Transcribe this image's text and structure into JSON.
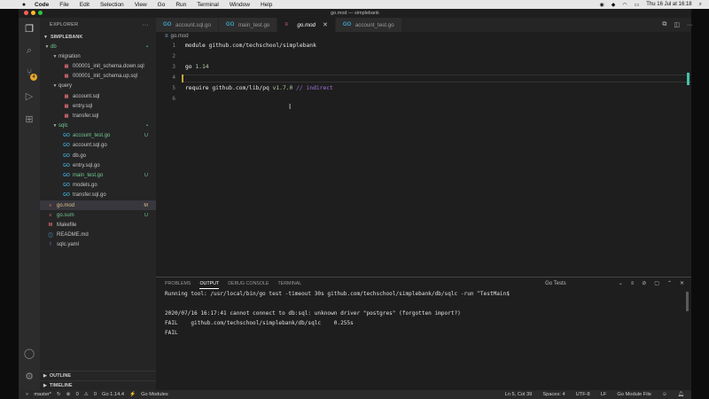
{
  "menubar": {
    "app": "Code",
    "items": [
      "File",
      "Edit",
      "Selection",
      "View",
      "Go",
      "Run",
      "Terminal",
      "Window",
      "Help"
    ],
    "window_title": "go.mod — simplebank",
    "clock": "Thu 16 Jul at  16:18"
  },
  "explorer": {
    "header": "EXPLORER",
    "project": "SIMPLEBANK",
    "tree": [
      {
        "label": "db",
        "type": "folder",
        "depth": 0,
        "open": true,
        "color": "#73c991",
        "status": "•",
        "status_color": "#73c991"
      },
      {
        "label": "migration",
        "type": "folder",
        "depth": 1,
        "open": true,
        "color": "#c5c5c5"
      },
      {
        "label": "000001_init_schema.down.sql",
        "type": "sql",
        "depth": 2,
        "color": "#c5c5c5"
      },
      {
        "label": "000001_init_schema.up.sql",
        "type": "sql",
        "depth": 2,
        "color": "#c5c5c5"
      },
      {
        "label": "query",
        "type": "folder",
        "depth": 1,
        "open": true,
        "color": "#c5c5c5"
      },
      {
        "label": "account.sql",
        "type": "sql",
        "depth": 2,
        "color": "#c5c5c5"
      },
      {
        "label": "entry.sql",
        "type": "sql",
        "depth": 2,
        "color": "#c5c5c5"
      },
      {
        "label": "transfer.sql",
        "type": "sql",
        "depth": 2,
        "color": "#c5c5c5"
      },
      {
        "label": "sqlc",
        "type": "folder",
        "depth": 1,
        "open": true,
        "color": "#73c991",
        "status": "•",
        "status_color": "#73c991"
      },
      {
        "label": "account_test.go",
        "type": "go",
        "depth": 2,
        "color": "#73c991",
        "status": "U",
        "status_color": "#73c991"
      },
      {
        "label": "account.sql.go",
        "type": "go",
        "depth": 2,
        "color": "#c5c5c5"
      },
      {
        "label": "db.go",
        "type": "go",
        "depth": 2,
        "color": "#c5c5c5"
      },
      {
        "label": "entry.sql.go",
        "type": "go",
        "depth": 2,
        "color": "#c5c5c5"
      },
      {
        "label": "main_test.go",
        "type": "go",
        "depth": 2,
        "color": "#73c991",
        "status": "U",
        "status_color": "#73c991"
      },
      {
        "label": "models.go",
        "type": "go",
        "depth": 2,
        "color": "#c5c5c5"
      },
      {
        "label": "transfer.sql.go",
        "type": "go",
        "depth": 2,
        "color": "#c5c5c5"
      },
      {
        "label": "go.mod",
        "type": "mod",
        "depth": 0,
        "color": "#e2c08d",
        "status": "M",
        "status_color": "#e2c08d",
        "selected": true
      },
      {
        "label": "go.sum",
        "type": "mod",
        "depth": 0,
        "color": "#73c991",
        "status": "U",
        "status_color": "#73c991"
      },
      {
        "label": "Makefile",
        "type": "make",
        "depth": 0,
        "color": "#c5c5c5"
      },
      {
        "label": "README.md",
        "type": "md",
        "depth": 0,
        "color": "#c5c5c5"
      },
      {
        "label": "sqlc.yaml",
        "type": "yaml",
        "depth": 0,
        "color": "#c5c5c5"
      }
    ],
    "outline": "OUTLINE",
    "timeline": "TIMELINE"
  },
  "tabs": [
    {
      "label": "account.sql.go",
      "active": false
    },
    {
      "label": "main_test.go",
      "active": false
    },
    {
      "label": "go.mod",
      "active": true
    },
    {
      "label": "account_test.go",
      "active": false
    }
  ],
  "breadcrumb": "go.mod",
  "editor": {
    "lines": [
      {
        "n": "1",
        "parts": [
          {
            "t": "module ",
            "c": "kw"
          },
          {
            "t": "github.com/techschool/simplebank",
            "c": "url"
          }
        ]
      },
      {
        "n": "2",
        "parts": []
      },
      {
        "n": "3",
        "parts": [
          {
            "t": "go ",
            "c": "kw"
          },
          {
            "t": "1.14",
            "c": "ver"
          }
        ]
      },
      {
        "n": "4",
        "parts": []
      },
      {
        "n": "5",
        "parts": [
          {
            "t": "require ",
            "c": "kw"
          },
          {
            "t": "github.com/lib/pq ",
            "c": "url"
          },
          {
            "t": "v1.7.0 ",
            "c": "ver"
          },
          {
            "t": "// indirect",
            "c": "cmt"
          }
        ]
      },
      {
        "n": "6",
        "parts": []
      }
    ]
  },
  "panel": {
    "tabs": [
      "PROBLEMS",
      "OUTPUT",
      "DEBUG CONSOLE",
      "TERMINAL"
    ],
    "active_tab": "OUTPUT",
    "channel": "Go Tests",
    "output": [
      "Running tool: /usr/local/bin/go test -timeout 30s github.com/techschool/simplebank/db/sqlc -run ^TestMain$",
      "",
      "2020/07/16 16:17:41 cannot connect to db:sql: unknown driver \"postgres\" (forgotten import?)",
      "FAIL    github.com/techschool/simplebank/db/sqlc    0.255s",
      "FAIL"
    ]
  },
  "status": {
    "branch": "master*",
    "errors": "0",
    "warnings": "0",
    "go_version": "Go 1.14.4",
    "go_modules": "Go Modules",
    "position": "Ln 5, Col 39",
    "spaces": "Spaces: 4",
    "encoding": "UTF-8",
    "eol": "LF",
    "language": "Go Module File"
  }
}
